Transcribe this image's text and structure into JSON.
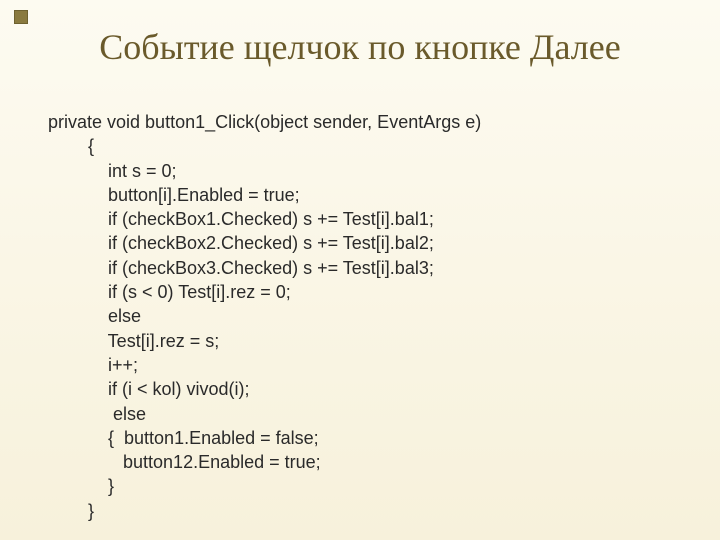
{
  "slide": {
    "title": "Событие щелчок по кнопке Далее",
    "code": "private void button1_Click(object sender, EventArgs e)\n        {\n            int s = 0;\n            button[i].Enabled = true;\n            if (checkBox1.Checked) s += Test[i].bal1;\n            if (checkBox2.Checked) s += Test[i].bal2;\n            if (checkBox3.Checked) s += Test[i].bal3;\n            if (s < 0) Test[i].rez = 0;\n            else\n            Test[i].rez = s;\n            i++;\n            if (i < kol) vivod(i);\n             else\n            {  button1.Enabled = false;\n               button12.Enabled = true;\n            }\n        }"
  }
}
